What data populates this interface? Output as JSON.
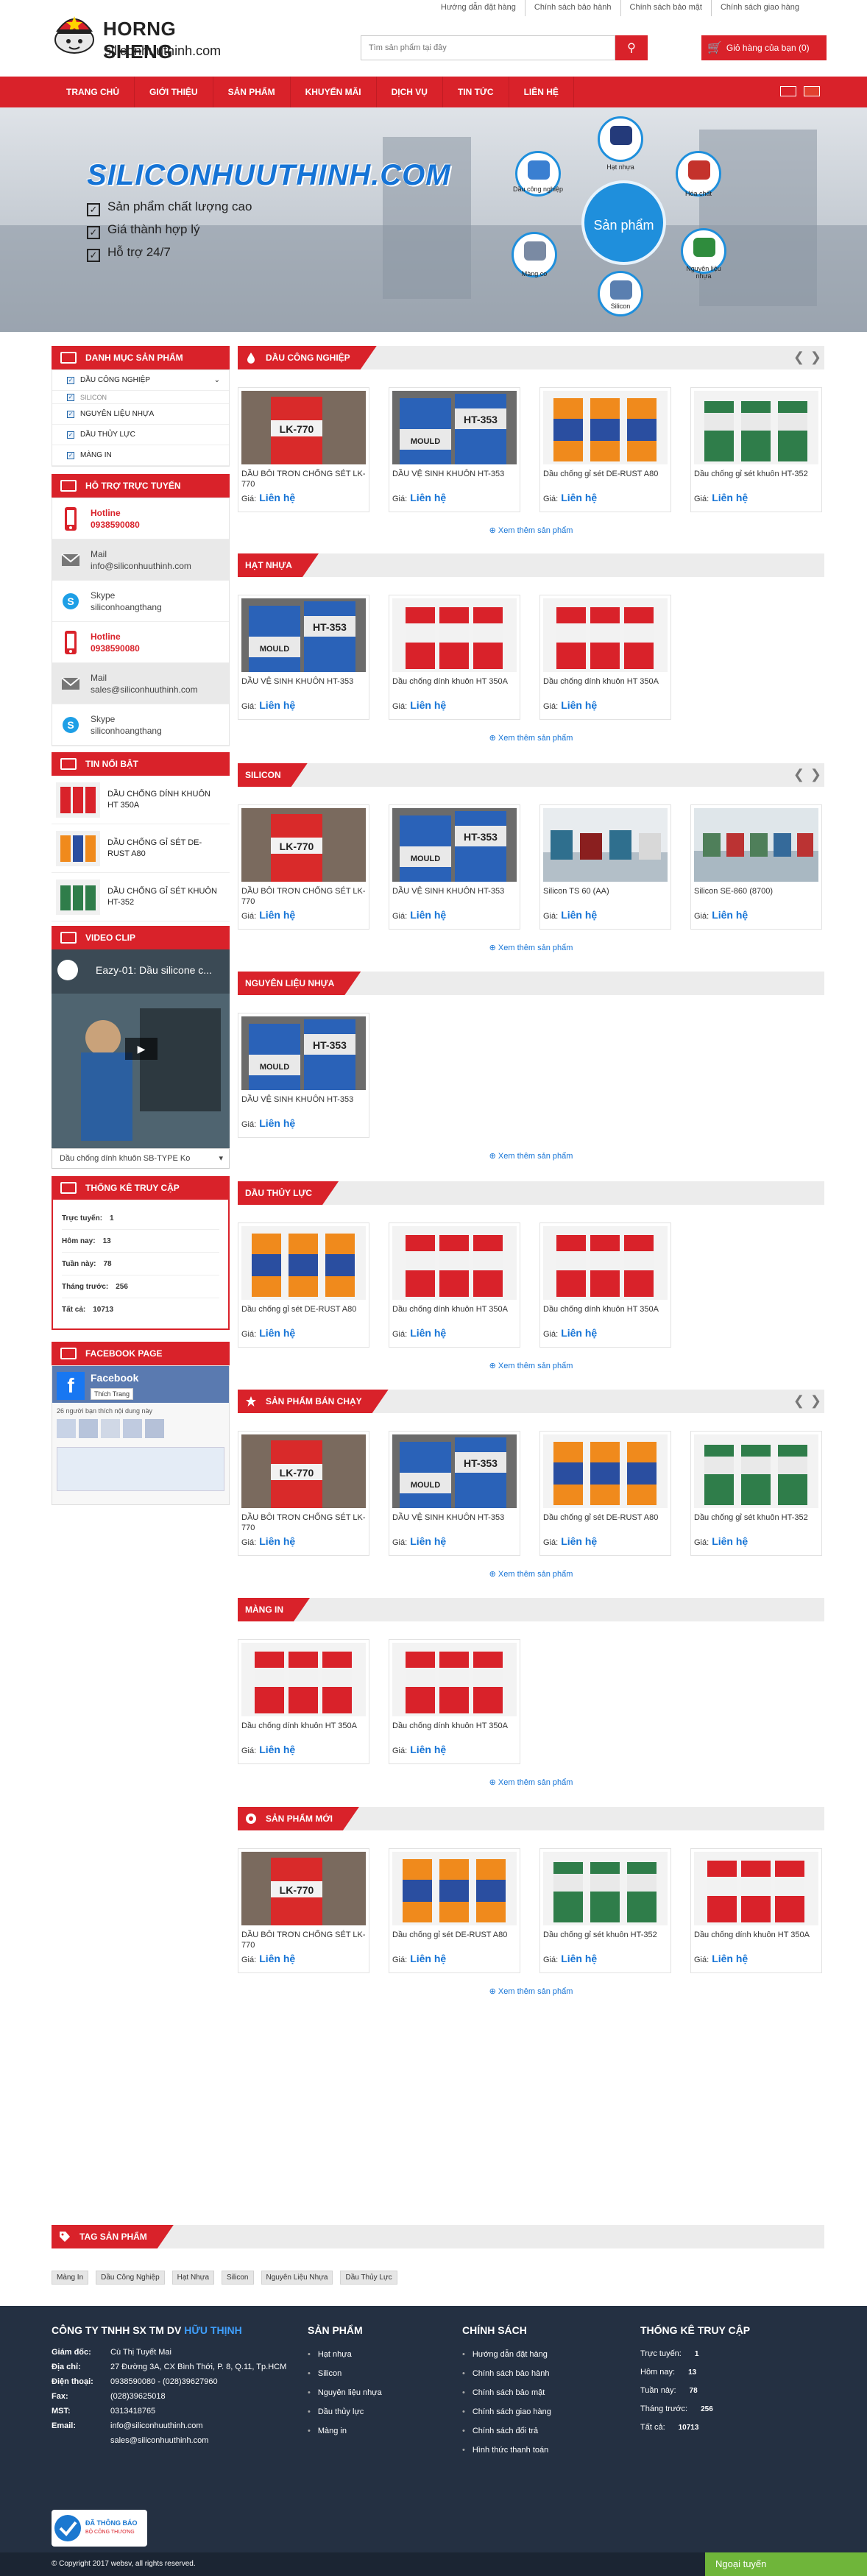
{
  "toplinks": [
    "Hướng dẫn đặt hàng",
    "Chính sách bảo hành",
    "Chính sách bảo mật",
    "Chính sách giao hàng"
  ],
  "logo": {
    "name": "HORNG SHENG",
    "domain": "siliconhuuthinh.com"
  },
  "search": {
    "placeholder": "Tìm sản phẩm tại đây"
  },
  "cart": {
    "label": "Giỏ hàng của bạn (0)"
  },
  "nav": [
    "TRANG CHỦ",
    "GIỚI THIỆU",
    "SẢN PHẨM",
    "KHUYẾN MÃI",
    "DỊCH VỤ",
    "TIN TỨC",
    "LIÊN HỆ"
  ],
  "banner": {
    "title": "SILICONHUUTHINH.COM",
    "lines": [
      "Sản phẩm chất lượng cao",
      "Giá thành hợp lý",
      "Hỗ trợ 24/7"
    ],
    "hub": "Sản phẩm",
    "items": [
      "Hạt nhựa",
      "Dầu công nghiệp",
      "Hóa chất",
      "Nguyên liệu nhựa",
      "Màng co",
      "Silicon"
    ]
  },
  "sidebar": {
    "categories_title": "DANH MỤC SẢN PHẨM",
    "categories": [
      "DẦU CÔNG NGHIỆP",
      "SILICON",
      "NGUYÊN LIỆU NHỰA",
      "DẦU THỦY LỰC",
      "MÀNG IN"
    ],
    "support_title": "HỖ TRỢ TRỰC TUYẾN",
    "support": [
      {
        "type": "Hotline",
        "value": "0938590080",
        "style": "red"
      },
      {
        "type": "Mail",
        "value": "info@siliconhuuthinh.com",
        "style": "gray"
      },
      {
        "type": "Skype",
        "value": "siliconhoangthang",
        "style": "skype"
      },
      {
        "type": "Hotline",
        "value": "0938590080",
        "style": "red"
      },
      {
        "type": "Mail",
        "value": "sales@siliconhuuthinh.com",
        "style": "gray"
      },
      {
        "type": "Skype",
        "value": "siliconhoangthang",
        "style": "skype"
      }
    ],
    "news_title": "TIN NỔI BẬT",
    "news": [
      "DẦU CHỐNG DÍNH KHUÔN HT 350A",
      "DẦU CHỐNG GỈ SÉT DE-RUST A80",
      "DẦU CHỐNG GỈ SÉT KHUÔN HT-352"
    ],
    "video_title": "VIDEO CLIP",
    "video_caption": "Eazy-01: Dầu silicone c...",
    "video_select": "Dầu chống dính khuôn SB-TYPE Ko",
    "stats_title": "THỐNG KÊ TRUY CẬP",
    "stats": [
      {
        "label": "Trực tuyến:",
        "value": "1"
      },
      {
        "label": "Hôm nay:",
        "value": "13"
      },
      {
        "label": "Tuần này:",
        "value": "78"
      },
      {
        "label": "Tháng trước:",
        "value": "256"
      },
      {
        "label": "Tất cả:",
        "value": "10713"
      }
    ],
    "fb_title": "FACEBOOK PAGE",
    "fb_name": "Facebook",
    "fb_like": "Thích Trang",
    "fb_count": "26 người bạn thích nội dung này"
  },
  "price_label": "Giá:",
  "price_value": "Liên hệ",
  "more_label": "Xem thêm sản phẩm",
  "sections": [
    {
      "title": "DẦU CÔNG NGHIỆP",
      "arrows": true,
      "icon": true,
      "products": [
        {
          "name": "DẦU BÔI TRƠN CHỐNG SÉT LK-770",
          "img": "red"
        },
        {
          "name": "DẦU VỆ SINH KHUÔN HT-353",
          "img": "blue"
        },
        {
          "name": "Dầu chống gỉ sét DE-RUST A80",
          "img": "rust"
        },
        {
          "name": "Dầu chống gỉ sét khuôn HT-352",
          "img": "green"
        }
      ]
    },
    {
      "title": "HẠT NHỰA",
      "arrows": false,
      "icon": false,
      "products": [
        {
          "name": "DẦU VỆ SINH KHUÔN HT-353",
          "img": "blue"
        },
        {
          "name": "Dầu chống dính khuôn HT 350A",
          "img": "redcan"
        },
        {
          "name": "Dầu chống dính khuôn HT 350A",
          "img": "redcan"
        }
      ]
    },
    {
      "title": "SILICON",
      "arrows": true,
      "icon": false,
      "products": [
        {
          "name": "DẦU BÔI TRƠN CHỐNG SÉT LK-770",
          "img": "red"
        },
        {
          "name": "DẦU VỆ SINH KHUÔN HT-353",
          "img": "blue"
        },
        {
          "name": "Silicon TS 60 (AA)",
          "img": "silicon"
        },
        {
          "name": "Silicon SE-860 (8700)",
          "img": "silicon2"
        }
      ]
    },
    {
      "title": "NGUYÊN LIỆU NHỰA",
      "arrows": false,
      "icon": false,
      "products": [
        {
          "name": "DẦU VỆ SINH KHUÔN HT-353",
          "img": "blue"
        }
      ]
    },
    {
      "title": "DẦU THỦY LỰC",
      "arrows": false,
      "icon": false,
      "products": [
        {
          "name": "Dầu chống gỉ sét DE-RUST A80",
          "img": "rust"
        },
        {
          "name": "Dầu chống dính khuôn HT 350A",
          "img": "redcan"
        },
        {
          "name": "Dầu chống dính khuôn HT 350A",
          "img": "redcan"
        }
      ]
    },
    {
      "title": "SẢN PHẨM BÁN CHẠY",
      "arrows": true,
      "icon": true,
      "products": [
        {
          "name": "DẦU BÔI TRƠN CHỐNG SÉT LK-770",
          "img": "red"
        },
        {
          "name": "DẦU VỆ SINH KHUÔN HT-353",
          "img": "blue"
        },
        {
          "name": "Dầu chống gỉ sét DE-RUST A80",
          "img": "rust"
        },
        {
          "name": "Dầu chống gỉ sét khuôn HT-352",
          "img": "green"
        }
      ]
    },
    {
      "title": "MÀNG IN",
      "arrows": false,
      "icon": false,
      "products": [
        {
          "name": "Dầu chống dính khuôn HT 350A",
          "img": "redcan"
        },
        {
          "name": "Dầu chống dính khuôn HT 350A",
          "img": "redcan"
        }
      ]
    },
    {
      "title": "SẢN PHẨM MỚI",
      "arrows": false,
      "icon": true,
      "products": [
        {
          "name": "DẦU BÔI TRƠN CHỐNG SÉT LK-770",
          "img": "red"
        },
        {
          "name": "Dầu chống gỉ sét DE-RUST A80",
          "img": "rust"
        },
        {
          "name": "Dầu chống gỉ sét khuôn HT-352",
          "img": "green"
        },
        {
          "name": "Dầu chống dính khuôn HT 350A",
          "img": "redcan"
        }
      ]
    }
  ],
  "tags": {
    "title": "TAG SẢN PHẨM",
    "items": [
      "Màng In",
      "Dầu Công Nghiệp",
      "Hạt Nhựa",
      "Silicon",
      "Nguyên Liệu Nhựa",
      "Dầu Thủy Lực"
    ]
  },
  "footer": {
    "company_prefix": "CÔNG TY TNHH SX TM DV",
    "company_name": "HỮU THỊNH",
    "info": [
      {
        "label": "Giám đốc:",
        "value": "Cù Thị Tuyết Mai"
      },
      {
        "label": "Địa chỉ:",
        "value": "27 Đường 3A, CX Bình Thới, P. 8, Q.11, Tp.HCM"
      },
      {
        "label": "Điện thoại:",
        "value": "0938590080 - (028)39627960"
      },
      {
        "label": "Fax:",
        "value": "(028)39625018"
      },
      {
        "label": "MST:",
        "value": "0313418765"
      },
      {
        "label": "Email:",
        "value": "info@siliconhuuthinh.com"
      },
      {
        "label": "",
        "value": "sales@siliconhuuthinh.com"
      }
    ],
    "badge_line1": "ĐÃ THÔNG BÁO",
    "badge_line2": "BỘ CÔNG THƯƠNG",
    "products_title": "SẢN PHẨM",
    "products": [
      "Hạt nhựa",
      "Silicon",
      "Nguyên liệu nhựa",
      "Dầu thủy lực",
      "Màng in"
    ],
    "policy_title": "CHÍNH SÁCH",
    "policy": [
      "Hướng dẫn đặt hàng",
      "Chính sách bảo hành",
      "Chính sách bảo mật",
      "Chính sách giao hàng",
      "Chính sách đổi trả",
      "Hình thức thanh toán"
    ],
    "stats_title": "THỐNG KÊ TRUY CẬP",
    "copyright": "© Copyright 2017 websv, all rights reserved.",
    "online": "Ngoại tuyến"
  }
}
